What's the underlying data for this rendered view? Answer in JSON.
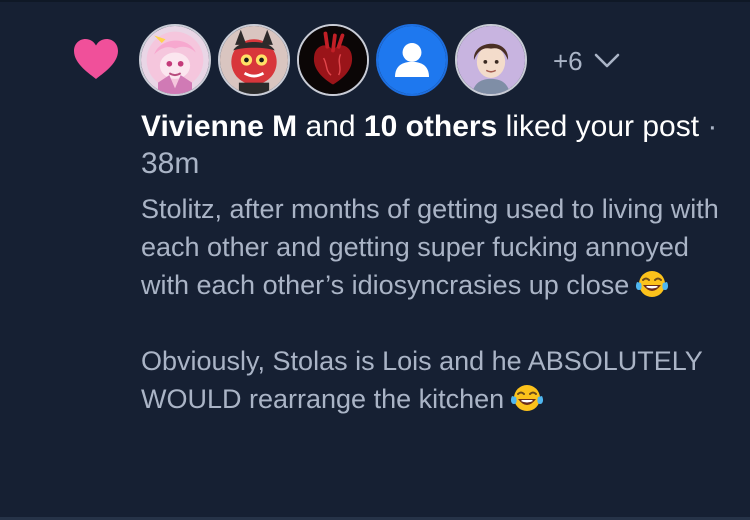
{
  "notification": {
    "type": "like",
    "accent_color": "#f0509a",
    "background_color": "#162033",
    "avatars": [
      {
        "icon": "pink-cartoon-avatar"
      },
      {
        "icon": "red-demon-avatar"
      },
      {
        "icon": "anatomical-heart-avatar"
      },
      {
        "icon": "default-user-avatar"
      },
      {
        "icon": "brown-hair-cartoon-avatar"
      }
    ],
    "more_count": "+6",
    "actor_name": "Vivienne M",
    "connector": " and ",
    "others_text": "10 others",
    "action_text": " liked your post",
    "separator": " · ",
    "time": "38m"
  },
  "post": {
    "paragraph1": "Stolitz, after months of getting used to living with each other and getting super fucking annoyed with each other’s idiosyncrasies up close",
    "paragraph2": "Obviously, Stolas is Lois and he ABSOLUTELY WOULD rearrange the kitchen",
    "emoji": "face-with-tears-of-joy"
  }
}
